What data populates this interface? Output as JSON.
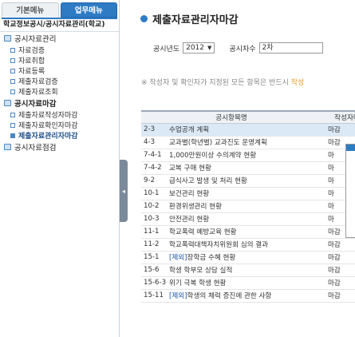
{
  "sidebar": {
    "tabs": [
      {
        "label": "기본메뉴",
        "active": false
      },
      {
        "label": "업무메뉴",
        "active": true
      }
    ],
    "title": "학교정보공시/공시자료관리(학교)",
    "groups": [
      {
        "label": "공시자료관리",
        "items": [
          "자료검증",
          "자료취합",
          "자료등록",
          "제출자료검증",
          "제출자료조회"
        ]
      },
      {
        "label": "공시자료마감",
        "items": [
          "제출자료작성자마감",
          "제출자료확인자마감",
          "제출자료관리자마감"
        ]
      },
      {
        "label": "공시자료점검",
        "items": []
      }
    ],
    "active_item": "제출자료관리자마감"
  },
  "main": {
    "title": "제출자료관리자마감",
    "filters": {
      "year_label": "공시년도",
      "year_value": "2012",
      "round_label": "공시차수",
      "round_value": "2차"
    },
    "notice": {
      "text": "※ 작성자 및 확인자가 지정된 모든 항목은 반드시",
      "highlight": "작성"
    },
    "table": {
      "headers": [
        "공시항목명",
        "작성자마"
      ],
      "rows": [
        {
          "code": "2-3",
          "name": "수업공개 계획",
          "status": "마감",
          "selected": true
        },
        {
          "code": "4-3",
          "name": "교과별(학년별) 교과진도 운영계획",
          "status": "마감"
        },
        {
          "code": "7-4-1",
          "name": "1,000만원이상 수의계약 현황",
          "status": "마"
        },
        {
          "code": "7-4-2",
          "name": "교복 구매 현황",
          "status": "마"
        },
        {
          "code": "9-2",
          "name": "급식사고 발생 및 처리 현황",
          "status": "마"
        },
        {
          "code": "10-1",
          "name": "보건관리 현황",
          "status": "마"
        },
        {
          "code": "10-2",
          "name": "환경위생관리 현황",
          "status": "마"
        },
        {
          "code": "10-3",
          "name": "안전관리 현황",
          "status": "마"
        },
        {
          "code": "11-1",
          "name": "학교폭력 예방교육 현황",
          "status": "마감"
        },
        {
          "code": "11-2",
          "name": "학교폭력대책자치위원회 심의 결과",
          "status": "마감"
        },
        {
          "code": "15-1",
          "tag": "[제외]",
          "name": "장학금 수혜 현황",
          "status": "마감"
        },
        {
          "code": "15-6",
          "name": "학생 학부모 상담 실적",
          "status": "마감"
        },
        {
          "code": "15-6-3",
          "name": "위기 극복 학생 현황",
          "status": "마감"
        },
        {
          "code": "15-11",
          "tag": "[제외]",
          "name": "학생의 체력 증진에 관한 사항",
          "status": "마감"
        }
      ]
    }
  }
}
